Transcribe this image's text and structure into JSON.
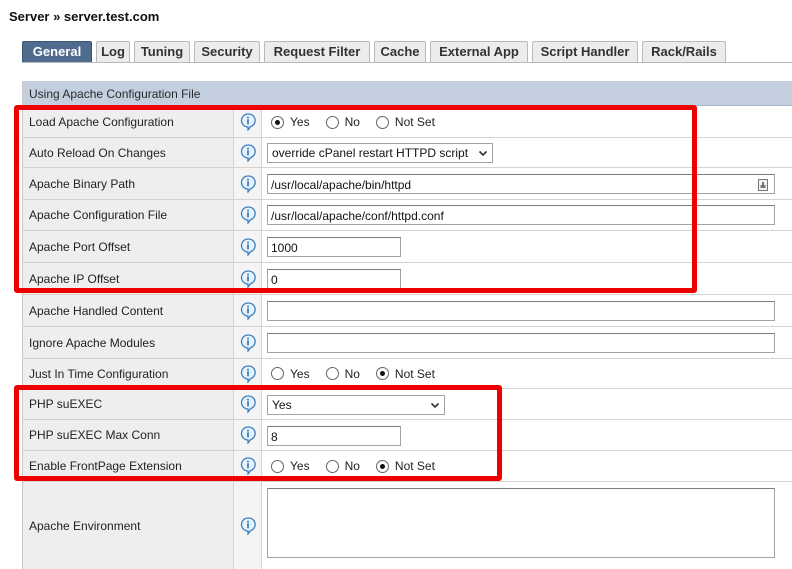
{
  "breadcrumb": "Server » server.test.com",
  "tabs": [
    {
      "label": "General",
      "active": true
    },
    {
      "label": "Log",
      "active": false
    },
    {
      "label": "Tuning",
      "active": false
    },
    {
      "label": "Security",
      "active": false
    },
    {
      "label": "Request Filter",
      "active": false
    },
    {
      "label": "Cache",
      "active": false
    },
    {
      "label": "External App",
      "active": false
    },
    {
      "label": "Script Handler",
      "active": false
    },
    {
      "label": "Rack/Rails",
      "active": false
    }
  ],
  "section_title": "Using Apache Configuration File",
  "radio_labels": {
    "yes": "Yes",
    "no": "No",
    "not_set": "Not Set"
  },
  "rows": {
    "load_apache_config": {
      "label": "Load Apache Configuration",
      "selected": "Yes"
    },
    "auto_reload": {
      "label": "Auto Reload On Changes",
      "value": "override cPanel restart HTTPD script"
    },
    "apache_binary_path": {
      "label": "Apache Binary Path",
      "value": "/usr/local/apache/bin/httpd"
    },
    "apache_config_file": {
      "label": "Apache Configuration File",
      "value": "/usr/local/apache/conf/httpd.conf"
    },
    "apache_port_offset": {
      "label": "Apache Port Offset",
      "value": "1000"
    },
    "apache_ip_offset": {
      "label": "Apache IP Offset",
      "value": "0"
    },
    "apache_handled_content": {
      "label": "Apache Handled Content",
      "value": ""
    },
    "ignore_apache_modules": {
      "label": "Ignore Apache Modules",
      "value": ""
    },
    "just_in_time_config": {
      "label": "Just In Time Configuration",
      "selected": "Not Set"
    },
    "php_suexec": {
      "label": "PHP suEXEC",
      "value": "Yes"
    },
    "php_suexec_max_conn": {
      "label": "PHP suEXEC Max Conn",
      "value": "8"
    },
    "enable_frontpage": {
      "label": "Enable FrontPage Extension",
      "selected": "Not Set"
    },
    "apache_environment": {
      "label": "Apache Environment",
      "value": ""
    }
  },
  "colors": {
    "active_tab": "#4f6b8e",
    "header_bg": "#c3cfdf",
    "highlight": "#ee0000",
    "info_icon": "#3a7fc0"
  },
  "icons": {
    "help": "info-icon",
    "dropdown": "chevron-down-icon",
    "file_browse": "file-browse-icon"
  }
}
